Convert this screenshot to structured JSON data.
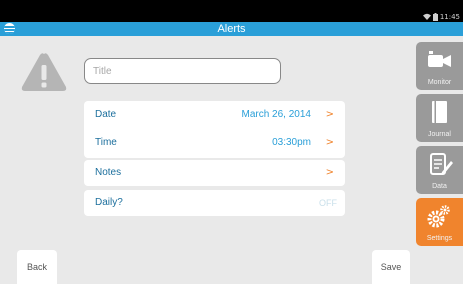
{
  "status_bar": {
    "time": "11:45",
    "icons": [
      "wifi-icon",
      "battery-icon"
    ]
  },
  "header": {
    "title": "Alerts",
    "logo_icon": "att-globe-icon"
  },
  "alert_form": {
    "warning_icon": "warning-triangle-icon",
    "title_input": {
      "value": "",
      "placeholder": "Title"
    },
    "date": {
      "label": "Date",
      "value": "March 26, 2014",
      "chevron": ">"
    },
    "time": {
      "label": "Time",
      "value": "03:30pm",
      "chevron": ">"
    },
    "notes": {
      "label": "Notes",
      "chevron": ">"
    },
    "daily": {
      "label": "Daily?",
      "value": "OFF"
    }
  },
  "side_tabs": [
    {
      "label": "Monitor",
      "icon": "video-camera-icon",
      "active": false
    },
    {
      "label": "Journal",
      "icon": "journal-icon",
      "active": false
    },
    {
      "label": "Data",
      "icon": "data-edit-icon",
      "active": false
    },
    {
      "label": "Settings",
      "icon": "gears-icon",
      "active": true
    }
  ],
  "footer": {
    "back_label": "Back",
    "save_label": "Save"
  },
  "colors": {
    "accent": "#2a9fd8",
    "active_tab": "#f0842d",
    "tab_inactive": "#9a9a9a",
    "label_text": "#1c6f9d"
  }
}
